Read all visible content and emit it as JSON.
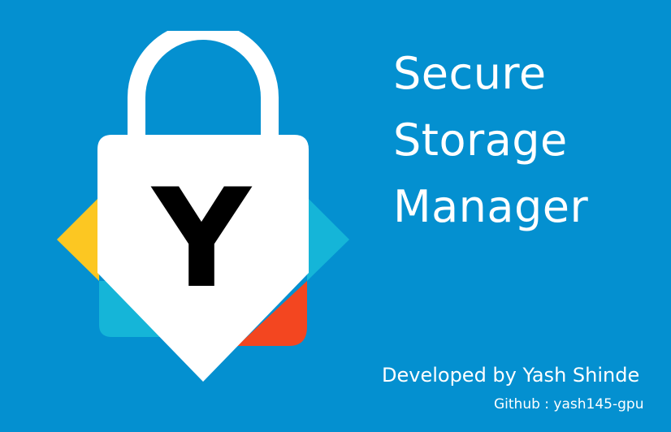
{
  "app": {
    "title_lines": [
      "Secure",
      "Storage",
      "Manager"
    ],
    "developer": "Developed by Yash Shinde",
    "github": "Github : yash145-gpu"
  },
  "logo": {
    "icon": "padlock-icon",
    "letter": "Y",
    "colors": {
      "background": "#0490d0",
      "lock_body": "#ffffff",
      "letter": "#000000",
      "yellow_facet": "#fcc722",
      "cyan_facet": "#15b5d8",
      "red_facet": "#f34620"
    }
  }
}
